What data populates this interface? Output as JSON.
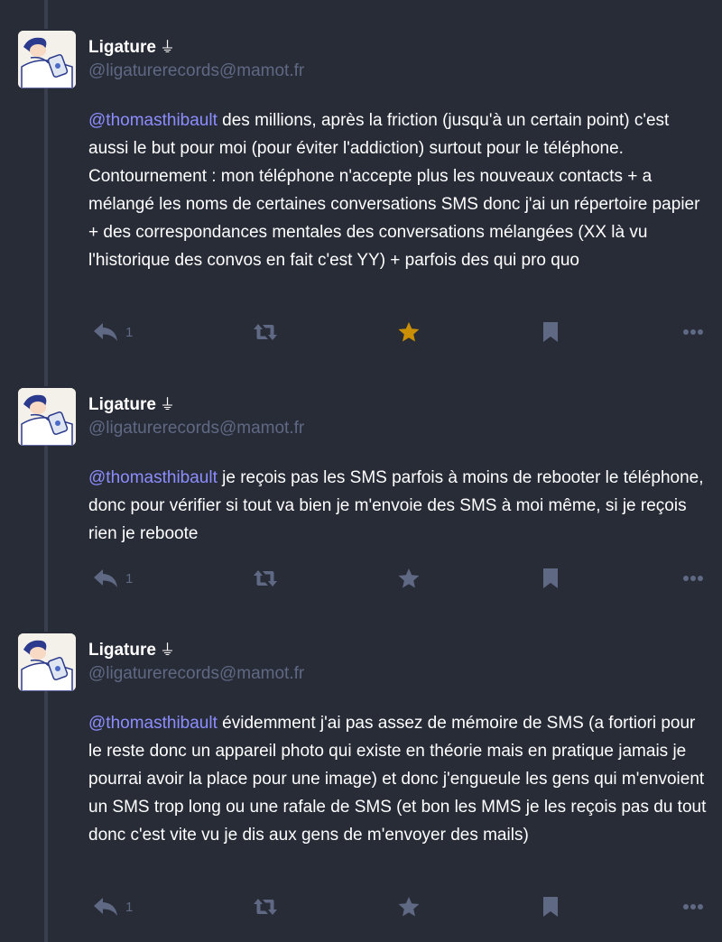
{
  "statuses": [
    {
      "display_name": "Ligature",
      "bot_icon": "⏚",
      "acct": "@ligaturerecords@mamot.fr",
      "mention": "@thomasthibault",
      "text": " des millions, après la friction (jusqu'à un certain point) c'est aussi le but pour moi (pour éviter l'addiction) surtout pour le téléphone. Contournement : mon téléphone n'accepte plus les nouveaux contacts + a  mélangé les noms de certaines conversations SMS donc j'ai un répertoire papier + des correspondances mentales des conversations mélangées (XX là vu l'historique des convos en fait c'est YY) + parfois des qui pro quo",
      "reply_count": "1",
      "favourited": true
    },
    {
      "display_name": "Ligature",
      "bot_icon": "⏚",
      "acct": "@ligaturerecords@mamot.fr",
      "mention": "@thomasthibault",
      "text": " je reçois pas les SMS parfois à moins de rebooter le téléphone, donc pour vérifier si tout va bien je m'envoie des SMS à moi même, si je reçois rien je reboote",
      "reply_count": "1",
      "favourited": false
    },
    {
      "display_name": "Ligature",
      "bot_icon": "⏚",
      "acct": "@ligaturerecords@mamot.fr",
      "mention": "@thomasthibault",
      "text": " évidemment j'ai pas assez de mémoire de SMS (a fortiori pour le reste donc un appareil photo qui existe en théorie mais en pratique jamais je pourrai avoir la place pour une image) et donc j'engueule les gens qui m'envoient un SMS trop long ou une rafale de SMS (et bon les MMS je les reçois pas du tout donc c'est vite vu je dis aux gens de m'envoyer des mails)",
      "reply_count": "1",
      "favourited": false
    }
  ],
  "icons": {
    "reply": "reply-icon",
    "boost": "boost-icon",
    "favourite": "star-icon",
    "bookmark": "bookmark-icon",
    "more": "ellipsis-icon",
    "avatar": "avatar-illustration"
  },
  "colors": {
    "background": "#282c37",
    "text": "#ffffff",
    "muted": "#606984",
    "mention": "#8c8dff",
    "favourite_active": "#ca8f04",
    "thread_line": "#393f4f"
  }
}
